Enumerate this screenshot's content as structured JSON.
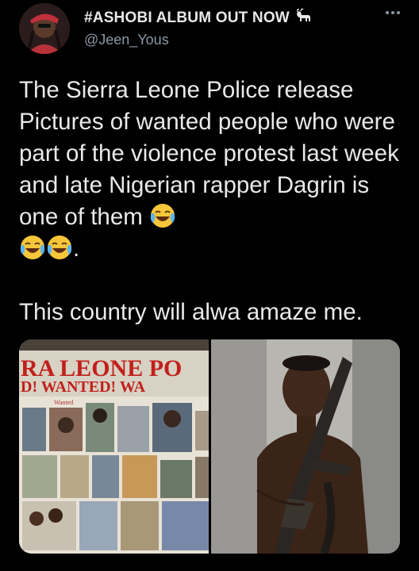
{
  "author": {
    "display_name": "#ASHOBI ALBUM OUT NOW",
    "handle": "@Jeen_Yous",
    "badge_icon": "goat-emoji"
  },
  "tweet": {
    "paragraph1": "The Sierra Leone Police release Pictures of wanted people who were part of the violence protest last week and late Nigerian rapper Dagrin is one of them",
    "paragraph1_tail": ".",
    "paragraph2": "This country will alwa amaze me.",
    "emoji_name": "face-with-tears-of-joy"
  },
  "media": {
    "poster_line1": "RA LEONE PO",
    "poster_line2": "D! WANTED! WA",
    "poster_small": "Wanted"
  },
  "colors": {
    "background": "#000000",
    "text": "#e7e9ea",
    "secondary": "#8b98a5",
    "poster_red": "#c0201c"
  }
}
